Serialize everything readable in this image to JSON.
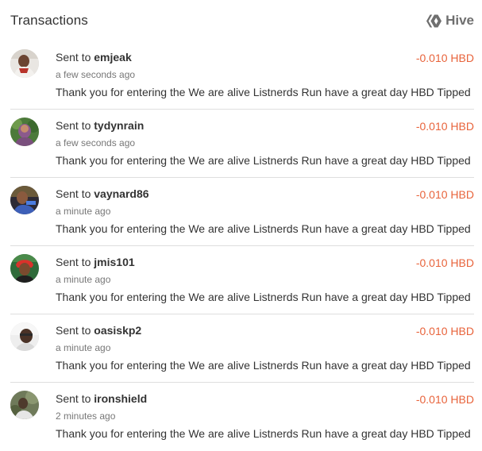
{
  "header": {
    "title": "Transactions",
    "brand_label": "Hive",
    "brand_icon": "hive-logo-icon"
  },
  "colors": {
    "accent_negative": "#e8633b",
    "text_primary": "#333333",
    "text_secondary": "#777777",
    "divider": "#dedede",
    "brand_gray": "#6f6f6f"
  },
  "transactions": [
    {
      "prefix": "Sent to ",
      "username": "emjeak",
      "time": "a few seconds ago",
      "memo": "Thank you for entering the We are alive Listnerds Run have a great day HBD Tipped",
      "amount": "-0.010 HBD"
    },
    {
      "prefix": "Sent to ",
      "username": "tydynrain",
      "time": "a few seconds ago",
      "memo": "Thank you for entering the We are alive Listnerds Run have a great day HBD Tipped",
      "amount": "-0.010 HBD"
    },
    {
      "prefix": "Sent to ",
      "username": "vaynard86",
      "time": "a minute ago",
      "memo": "Thank you for entering the We are alive Listnerds Run have a great day HBD Tipped",
      "amount": "-0.010 HBD"
    },
    {
      "prefix": "Sent to ",
      "username": "jmis101",
      "time": "a minute ago",
      "memo": "Thank you for entering the We are alive Listnerds Run have a great day HBD Tipped",
      "amount": "-0.010 HBD"
    },
    {
      "prefix": "Sent to ",
      "username": "oasiskp2",
      "time": "a minute ago",
      "memo": "Thank you for entering the We are alive Listnerds Run have a great day HBD Tipped",
      "amount": "-0.010 HBD"
    },
    {
      "prefix": "Sent to ",
      "username": "ironshield",
      "time": "2 minutes ago",
      "memo": "Thank you for entering the We are alive Listnerds Run have a great day HBD Tipped",
      "amount": "-0.010 HBD"
    }
  ]
}
